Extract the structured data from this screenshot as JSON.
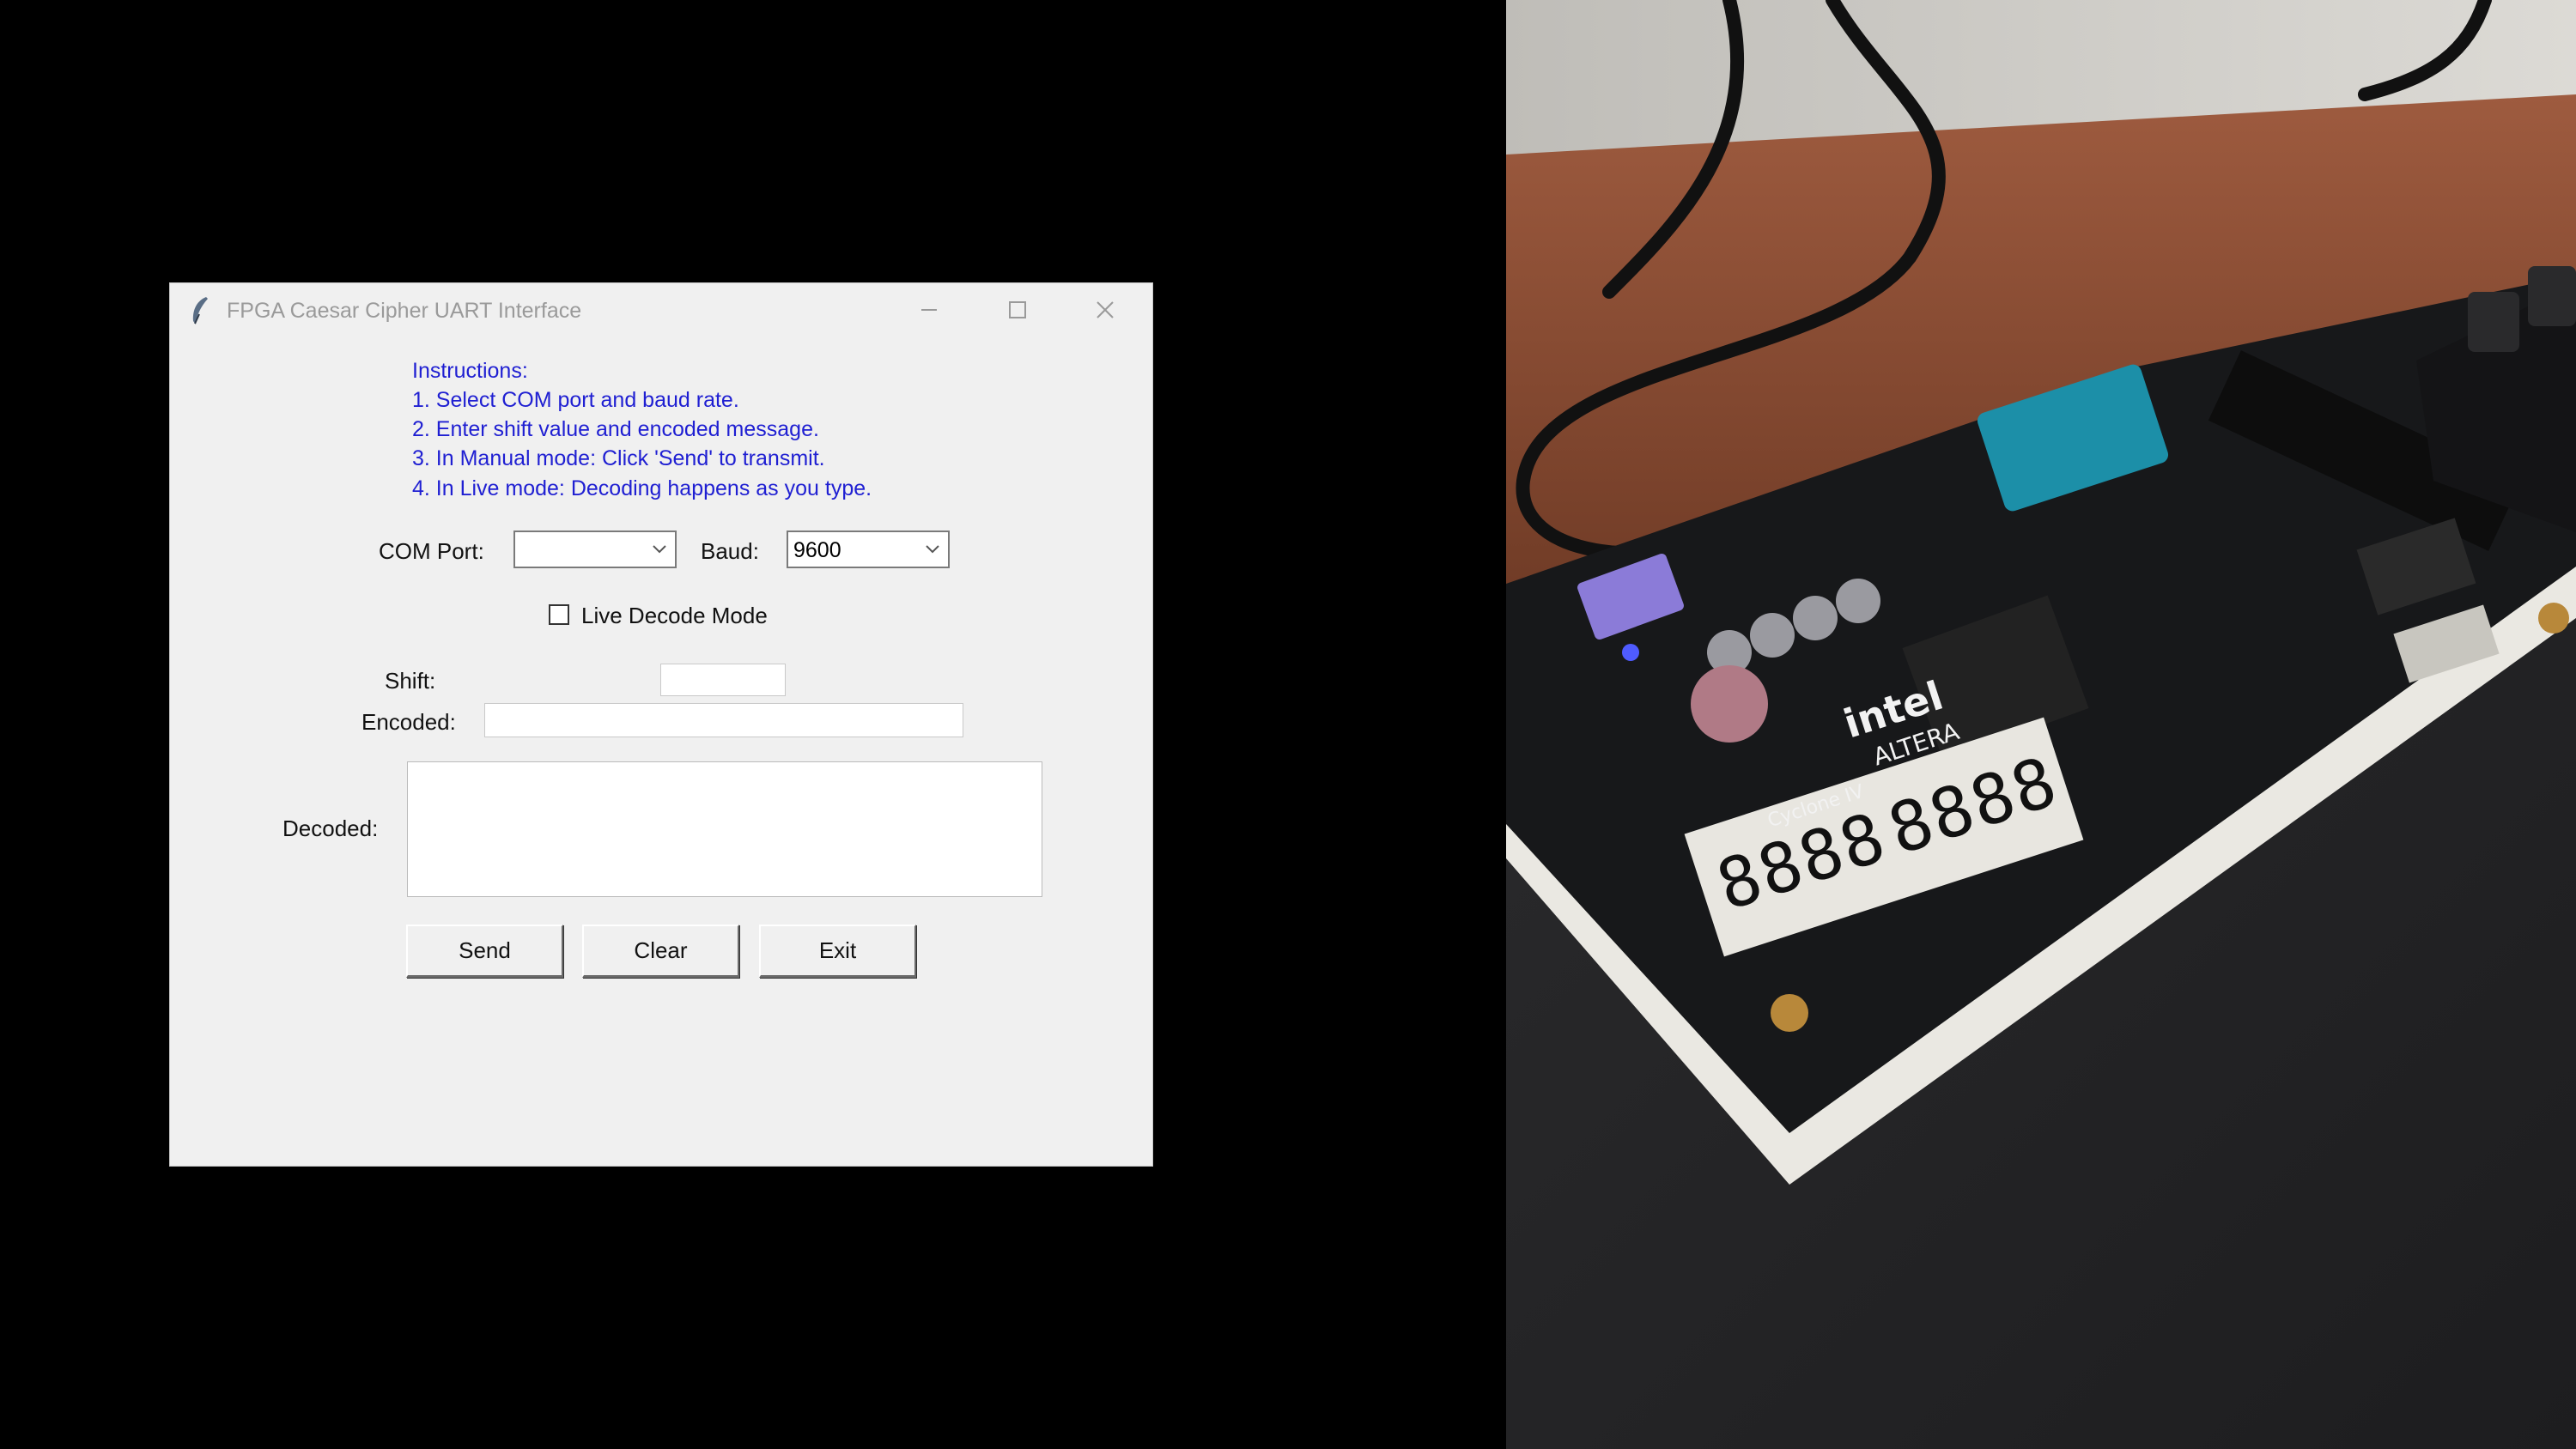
{
  "window": {
    "title": "FPGA Caesar Cipher UART Interface",
    "icon": "feather-icon",
    "controls": [
      "minimize-icon",
      "maximize-icon",
      "close-icon"
    ]
  },
  "instructions": [
    "Instructions:",
    "1. Select COM port and baud rate.",
    "2. Enter shift value and encoded message.",
    "3. In Manual mode: Click 'Send' to transmit.",
    "4. In Live mode: Decoding happens as you type."
  ],
  "com_port": {
    "label": "COM Port:",
    "value": ""
  },
  "baud": {
    "label": "Baud:",
    "value": "9600"
  },
  "live_mode": {
    "label": "Live Decode Mode",
    "checked": false
  },
  "shift": {
    "label": "Shift:",
    "value": ""
  },
  "encoded": {
    "label": "Encoded:",
    "value": ""
  },
  "decoded": {
    "label": "Decoded:",
    "value": ""
  },
  "buttons": {
    "send": "Send",
    "clear": "Clear",
    "exit": "Exit"
  },
  "photo": {
    "board_text": [
      "intel",
      "ALTERA",
      "Cyclone IV"
    ],
    "seven_segment_digits": [
      "8",
      "8",
      "8",
      "8",
      "8",
      "8",
      "8",
      "8"
    ]
  }
}
